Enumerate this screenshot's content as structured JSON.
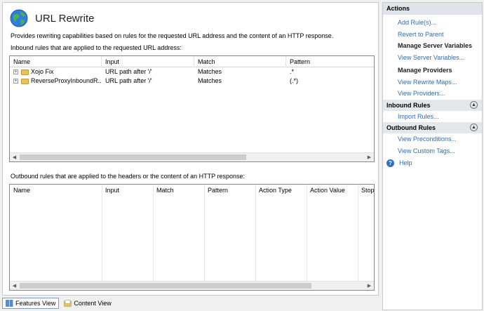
{
  "header": {
    "title": "URL Rewrite"
  },
  "description": "Provides rewriting capabilities based on rules for the requested URL address and the content of an HTTP response.",
  "inbound": {
    "label": "Inbound rules that are applied to the requested URL address:",
    "columns": [
      "Name",
      "Input",
      "Match",
      "Pattern"
    ],
    "rows": [
      {
        "name": "Xojo Fix",
        "input": "URL path after '/'",
        "match": "Matches",
        "pattern": ".*"
      },
      {
        "name": "ReverseProxyInboundR...",
        "input": "URL path after '/'",
        "match": "Matches",
        "pattern": "(.*)"
      }
    ]
  },
  "outbound": {
    "label": "Outbound rules that are applied to the headers or the content of an HTTP response:",
    "columns": [
      "Name",
      "Input",
      "Match",
      "Pattern",
      "Action Type",
      "Action Value",
      "Stop"
    ]
  },
  "views": {
    "features": "Features View",
    "content": "Content View"
  },
  "actions": {
    "title": "Actions",
    "top_links": [
      "Add Rule(s)...",
      "Revert to Parent"
    ],
    "server_vars_head": "Manage Server Variables",
    "server_vars_link": "View Server Variables...",
    "providers_head": "Manage Providers",
    "providers_links": [
      "View Rewrite Maps...",
      "View Providers..."
    ],
    "inbound_head": "Inbound Rules",
    "inbound_links": [
      "Import Rules..."
    ],
    "outbound_head": "Outbound Rules",
    "outbound_links": [
      "View Preconditions...",
      "View Custom Tags..."
    ],
    "help": "Help"
  },
  "colors": {
    "link": "#2f6bb3",
    "panel_header": "#dfe4ea"
  },
  "icons": {
    "page": "globe-icon",
    "help": "help-icon",
    "collapse": "chevron-up-icon",
    "row": "folder-icon"
  }
}
